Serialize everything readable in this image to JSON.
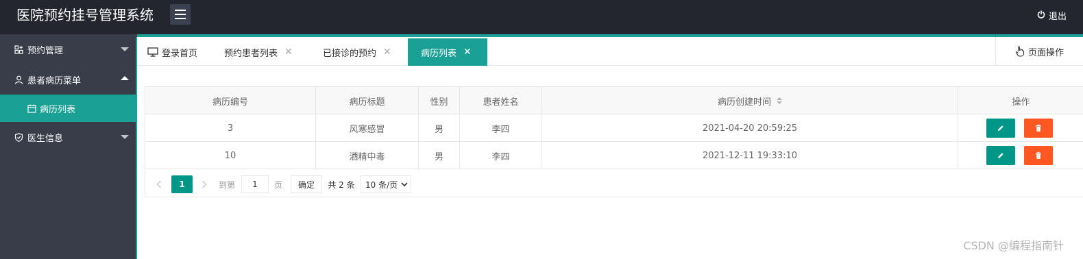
{
  "header": {
    "title": "医院预约挂号管理系统",
    "logout_label": "退出"
  },
  "sidebar": {
    "items": [
      {
        "label": "预约管理",
        "icon": "apps-icon",
        "expanded": false
      },
      {
        "label": "患者病历菜单",
        "icon": "user-icon",
        "expanded": true,
        "children": [
          {
            "label": "病历列表",
            "icon": "calendar-icon",
            "active": true
          }
        ]
      },
      {
        "label": "医生信息",
        "icon": "shield-icon",
        "expanded": false
      }
    ]
  },
  "tabs": [
    {
      "label": "登录首页",
      "icon": "monitor-icon",
      "closable": false,
      "active": false
    },
    {
      "label": "预约患者列表",
      "closable": true,
      "active": false
    },
    {
      "label": "已接诊的预约",
      "closable": true,
      "active": false
    },
    {
      "label": "病历列表",
      "closable": true,
      "active": true
    }
  ],
  "page_ops_label": "页面操作",
  "table": {
    "columns": [
      "病历编号",
      "病历标题",
      "性别",
      "患者姓名",
      "病历创建时间",
      "操作"
    ],
    "rows": [
      {
        "id": "3",
        "title": "风寒感冒",
        "gender": "男",
        "patient": "李四",
        "created": "2021-04-20 20:59:25"
      },
      {
        "id": "10",
        "title": "酒精中毒",
        "gender": "男",
        "patient": "李四",
        "created": "2021-12-11 19:33:10"
      }
    ]
  },
  "pager": {
    "current_page": "1",
    "goto_prefix": "到第",
    "goto_value": "1",
    "goto_suffix": "页",
    "confirm_label": "确定",
    "total_text": "共 2 条",
    "page_size": "10 条/页"
  },
  "watermark": "CSDN @编程指南针",
  "colors": {
    "header_bg": "#23262e",
    "sidebar_bg": "#393d49",
    "accent": "#1aa094",
    "primary_button": "#009688",
    "danger_button": "#ff5722"
  }
}
